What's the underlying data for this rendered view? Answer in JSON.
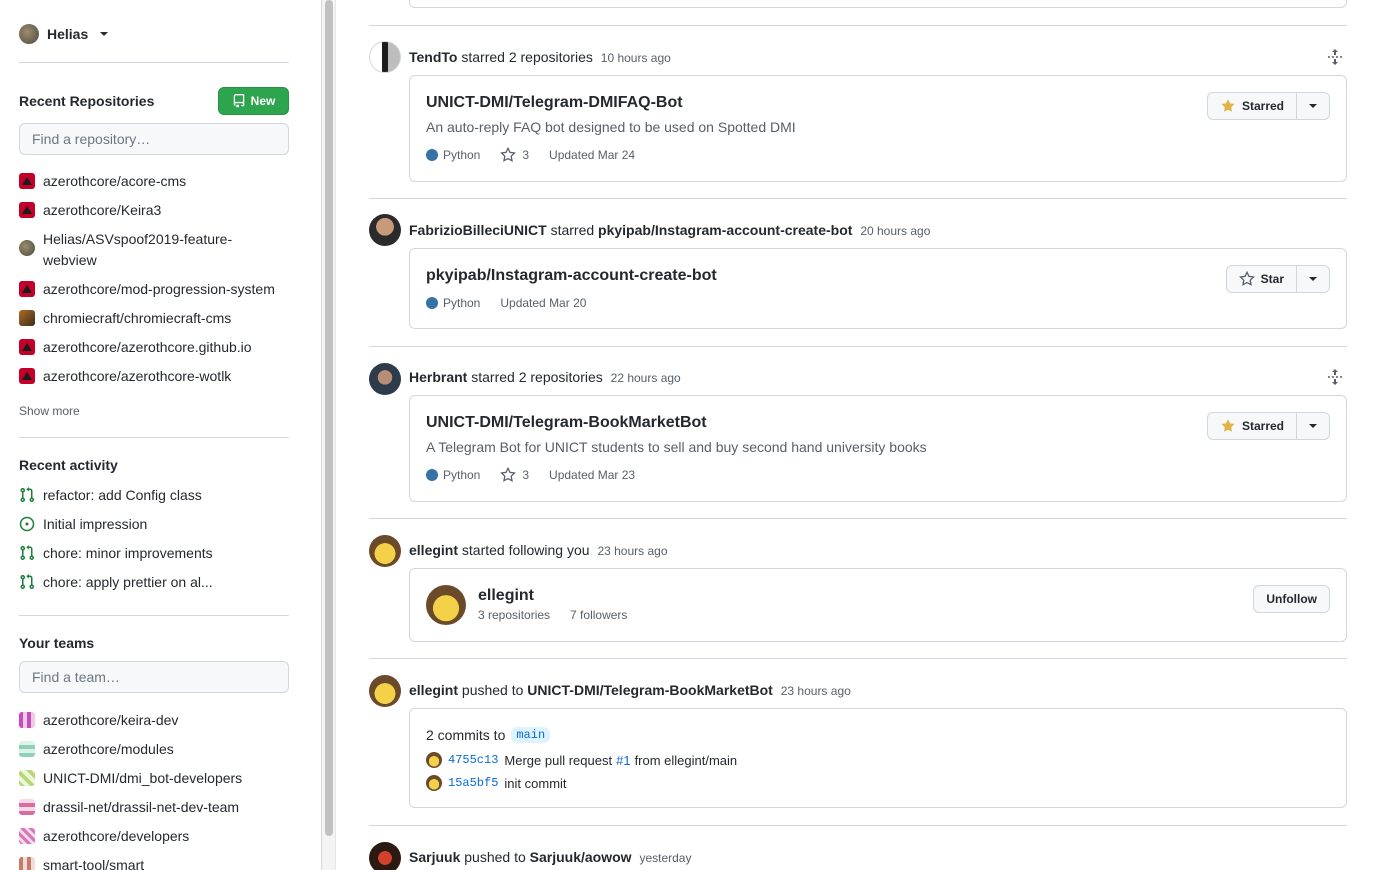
{
  "user": {
    "name": "Helias"
  },
  "sidebar": {
    "recent_repos_title": "Recent Repositories",
    "new_button": "New",
    "find_repo_placeholder": "Find a repository…",
    "repos": [
      {
        "label": "azerothcore/acore-cms",
        "icon": "azerothcore-icon"
      },
      {
        "label": "azerothcore/Keira3",
        "icon": "azerothcore-icon"
      },
      {
        "label": "Helias/ASVspoof2019-feature-webview",
        "icon": "helias-avatar"
      },
      {
        "label": "azerothcore/mod-progression-system",
        "icon": "azerothcore-icon"
      },
      {
        "label": "chromiecraft/chromiecraft-cms",
        "icon": "chromiecraft-icon"
      },
      {
        "label": "azerothcore/azerothcore.github.io",
        "icon": "azerothcore-icon"
      },
      {
        "label": "azerothcore/azerothcore-wotlk",
        "icon": "azerothcore-icon"
      }
    ],
    "show_more": "Show more",
    "recent_activity_title": "Recent activity",
    "activity": [
      {
        "label": "refactor: add Config class",
        "icon": "pull-request-icon"
      },
      {
        "label": "Initial impression",
        "icon": "issue-open-icon"
      },
      {
        "label": "chore: minor improvements",
        "icon": "pull-request-icon"
      },
      {
        "label": "chore: apply prettier on al...",
        "icon": "pull-request-icon"
      }
    ],
    "teams_title": "Your teams",
    "find_team_placeholder": "Find a team…",
    "teams": [
      {
        "label": "azerothcore/keira-dev"
      },
      {
        "label": "azerothcore/modules"
      },
      {
        "label": "UNICT-DMI/dmi_bot-developers"
      },
      {
        "label": "drassil-net/drassil-net-dev-team"
      },
      {
        "label": "azerothcore/developers"
      },
      {
        "label": "smart-tool/smart"
      }
    ]
  },
  "feed": {
    "events": [
      {
        "actor": "TendTo",
        "action": "starred 2 repositories",
        "time": "10 hours ago",
        "repo": {
          "name": "UNICT-DMI/Telegram-DMIFAQ-Bot",
          "description": "An auto-reply FAQ bot designed to be used on Spotted DMI",
          "language": "Python",
          "stars": "3",
          "updated": "Updated Mar 24",
          "star_label": "Starred"
        }
      },
      {
        "actor": "FabrizioBilleciUNICT",
        "action": "starred",
        "target": "pkyipab/Instagram-account-create-bot",
        "time": "20 hours ago",
        "repo": {
          "name": "pkyipab/Instagram-account-create-bot",
          "language": "Python",
          "updated": "Updated Mar 20",
          "star_label": "Star"
        }
      },
      {
        "actor": "Herbrant",
        "action": "starred 2 repositories",
        "time": "22 hours ago",
        "repo": {
          "name": "UNICT-DMI/Telegram-BookMarketBot",
          "description": "A Telegram Bot for UNICT students to sell and buy second hand university books",
          "language": "Python",
          "stars": "3",
          "updated": "Updated Mar 23",
          "star_label": "Starred"
        }
      },
      {
        "actor": "ellegint",
        "action": "started following you",
        "time": "23 hours ago",
        "profile": {
          "name": "ellegint",
          "repositories": "3 repositories",
          "followers": "7 followers",
          "button": "Unfollow"
        }
      },
      {
        "actor": "ellegint",
        "action": "pushed to",
        "target": "UNICT-DMI/Telegram-BookMarketBot",
        "time": "23 hours ago",
        "push": {
          "summary": "2 commits to",
          "branch": "main",
          "commits": [
            {
              "sha": "4755c13",
              "msg_before": "Merge pull request",
              "pr": "#1",
              "msg_after": "from ellegint/main"
            },
            {
              "sha": "15a5bf5",
              "msg": "init commit"
            }
          ]
        }
      },
      {
        "actor": "Sarjuuk",
        "action": "pushed to",
        "target": "Sarjuuk/aowow",
        "time": "yesterday"
      }
    ]
  },
  "colors": {
    "python": "#3572A5",
    "new_button": "#2da44e",
    "link": "#0969da",
    "star": "#e3b341"
  }
}
